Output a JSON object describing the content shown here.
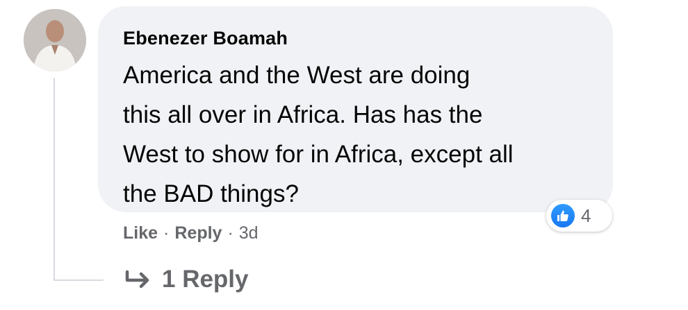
{
  "comment": {
    "author": "Ebenezer Boamah",
    "text_lines": [
      "America and the West are doing",
      "this all over in Africa. Has has the",
      "West to show for in Africa, except all",
      "the BAD things?"
    ],
    "reaction_count": "4",
    "reaction_icon": "like-icon",
    "accent_color": "#1877f2"
  },
  "actions": {
    "like_label": "Like",
    "separator": "·",
    "reply_label": "Reply",
    "time": "3d"
  },
  "replies": {
    "label": "1 Reply",
    "icon": "reply-arrow-icon"
  }
}
